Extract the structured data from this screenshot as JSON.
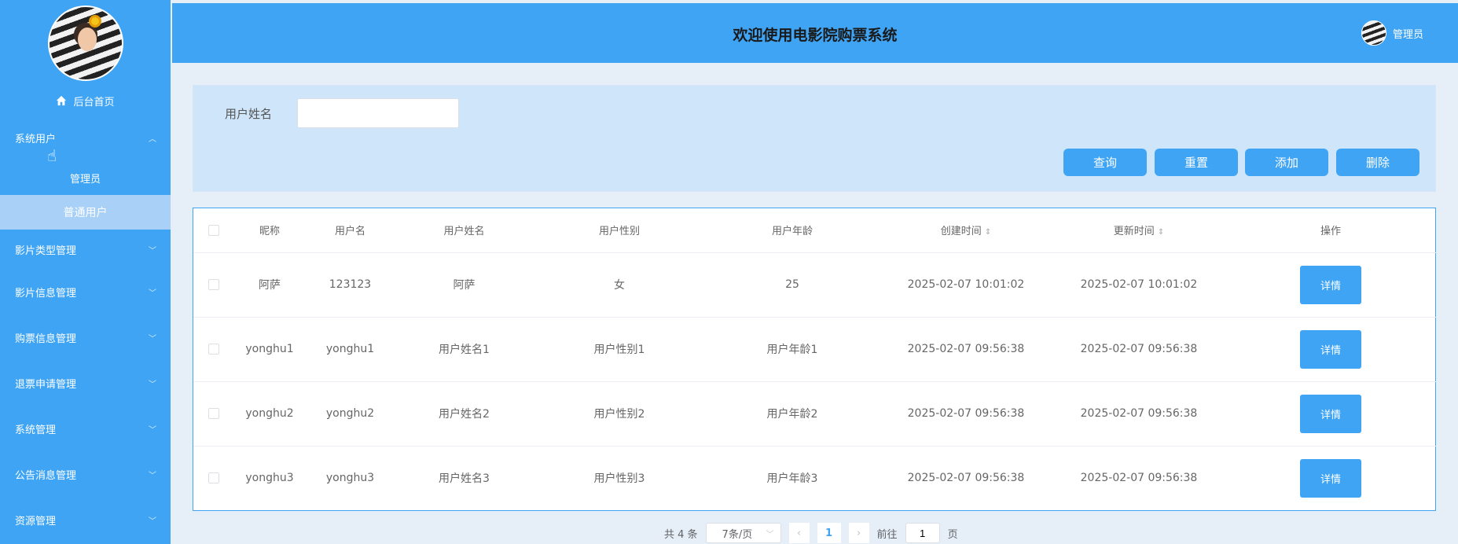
{
  "header": {
    "title": "欢迎使用电影院购票系统",
    "user_label": "管理员"
  },
  "sidebar": {
    "home_label": "后台首页",
    "groups": [
      {
        "label": "系统用户",
        "expanded": true,
        "children": [
          "管理员",
          "普通用户"
        ],
        "active_child": "普通用户"
      },
      {
        "label": "影片类型管理"
      },
      {
        "label": "影片信息管理"
      },
      {
        "label": "购票信息管理"
      },
      {
        "label": "退票申请管理"
      },
      {
        "label": "系统管理"
      },
      {
        "label": "公告消息管理"
      },
      {
        "label": "资源管理"
      }
    ]
  },
  "search": {
    "label": "用户姓名",
    "value": "",
    "buttons": {
      "query": "查询",
      "reset": "重置",
      "add": "添加",
      "delete": "删除"
    }
  },
  "table": {
    "columns": [
      "昵称",
      "用户名",
      "用户姓名",
      "用户性别",
      "用户年龄",
      "创建时间",
      "更新时间",
      "操作"
    ],
    "rows": [
      {
        "nickname": "阿萨",
        "username": "123123",
        "name": "阿萨",
        "gender": "女",
        "age": "25",
        "created": "2025-02-07 10:01:02",
        "updated": "2025-02-07 10:01:02",
        "action": "详情"
      },
      {
        "nickname": "yonghu1",
        "username": "yonghu1",
        "name": "用户姓名1",
        "gender": "用户性别1",
        "age": "用户年龄1",
        "created": "2025-02-07 09:56:38",
        "updated": "2025-02-07 09:56:38",
        "action": "详情"
      },
      {
        "nickname": "yonghu2",
        "username": "yonghu2",
        "name": "用户姓名2",
        "gender": "用户性别2",
        "age": "用户年龄2",
        "created": "2025-02-07 09:56:38",
        "updated": "2025-02-07 09:56:38",
        "action": "详情"
      },
      {
        "nickname": "yonghu3",
        "username": "yonghu3",
        "name": "用户姓名3",
        "gender": "用户性别3",
        "age": "用户年龄3",
        "created": "2025-02-07 09:56:38",
        "updated": "2025-02-07 09:56:38",
        "action": "详情"
      }
    ]
  },
  "pagination": {
    "total_label": "共 4 条",
    "page_size": "7条/页",
    "current_page": "1",
    "goto_label": "前往",
    "goto_value": "1",
    "page_suffix": "页"
  },
  "colors": {
    "primary": "#3fa4f4",
    "active_sub": "#a9d0f6",
    "panel": "#cfe5fa"
  }
}
